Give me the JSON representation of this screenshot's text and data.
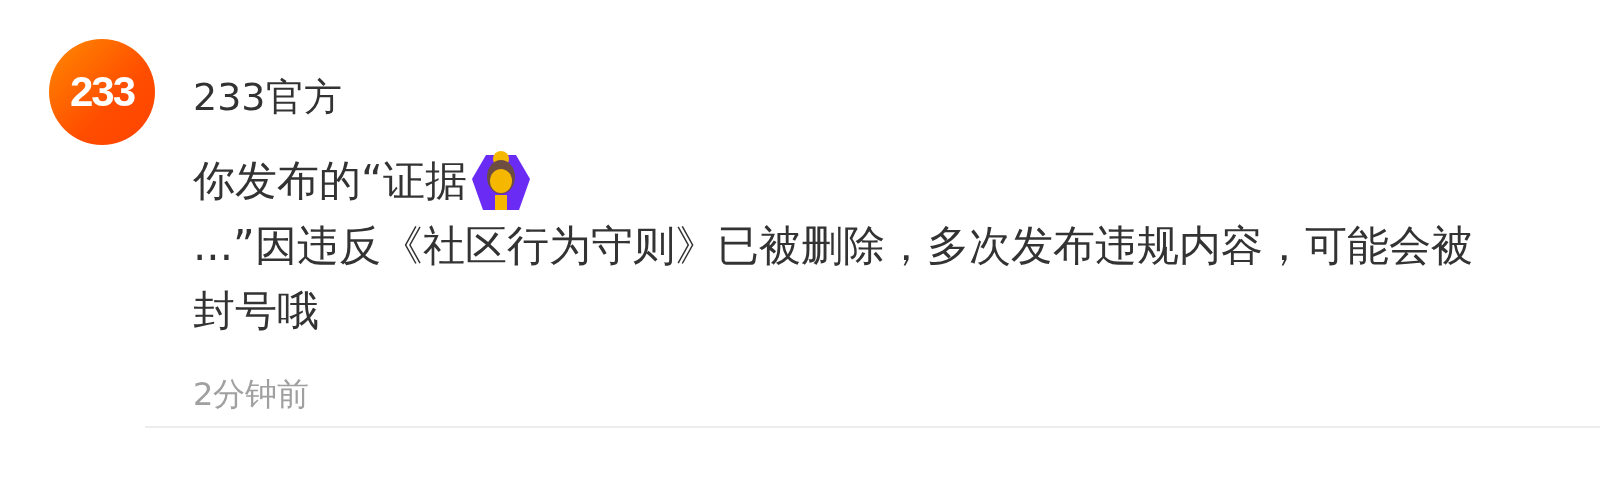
{
  "notification": {
    "avatar": {
      "logo_text": "233"
    },
    "sender": "233官方",
    "message": [
      {
        "kind": "text",
        "text": "你发布的“证据"
      },
      {
        "kind": "emoji"
      },
      {
        "kind": "text",
        "text": "...”因违反《社区行为守则》已被删除，多次发布违规内容，可能会被封号哦"
      }
    ],
    "time": "2分钟前"
  }
}
